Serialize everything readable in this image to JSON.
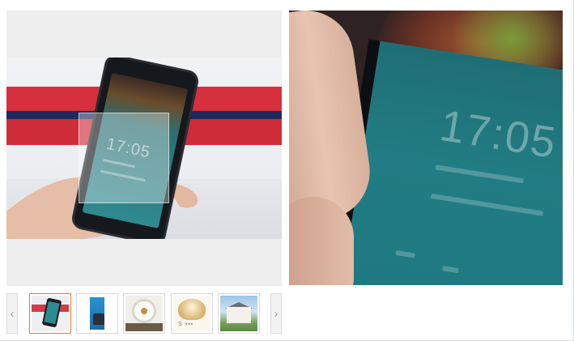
{
  "gallery": {
    "main_image": {
      "clock_text": "17:05",
      "alt": ""
    },
    "zoom_preview": {
      "clock_text": "17:05"
    },
    "thumbnails": [
      {
        "name": "phone-in-hand",
        "active": true
      },
      {
        "name": "blue-product-box",
        "active": false
      },
      {
        "name": "ceiling-lamp",
        "active": false
      },
      {
        "name": "chandelier",
        "active": false
      },
      {
        "name": "house-exterior",
        "active": false
      }
    ],
    "prev_label": "‹",
    "next_label": "›"
  },
  "colors": {
    "active_thumb_border": "#e7792b",
    "thumb_border": "#d9d9d9",
    "stage_bg": "#eeeeee"
  }
}
